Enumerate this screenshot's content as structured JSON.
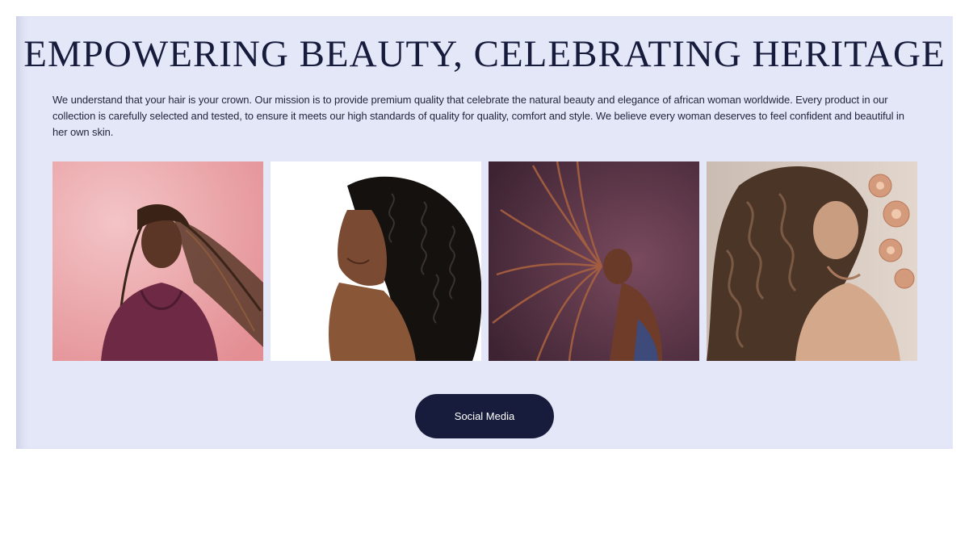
{
  "hero": {
    "title": "EMPOWERING BEAUTY, CELEBRATING HERITAGE",
    "description": "We understand that your hair is your crown. Our mission is to provide premium quality that celebrate the natural beauty and elegance of african woman worldwide. Every product in our collection is carefully selected and tested, to ensure it meets our high standards of quality for quality, comfort and style. We believe every woman deserves to feel confident and beautiful in her own skin."
  },
  "gallery": {
    "photos": [
      {
        "subject": "woman-with-braids-pink-backdrop"
      },
      {
        "subject": "woman-with-curly-hair-white-backdrop"
      },
      {
        "subject": "woman-flipping-braids-dark-backdrop"
      },
      {
        "subject": "woman-with-wavy-hair-and-flowers"
      }
    ]
  },
  "cta": {
    "label": "Social Media"
  },
  "colors": {
    "section_background": "#e4e7f8",
    "heading": "#181c3c",
    "button_background": "#181c3c",
    "button_text": "#ffffff"
  }
}
